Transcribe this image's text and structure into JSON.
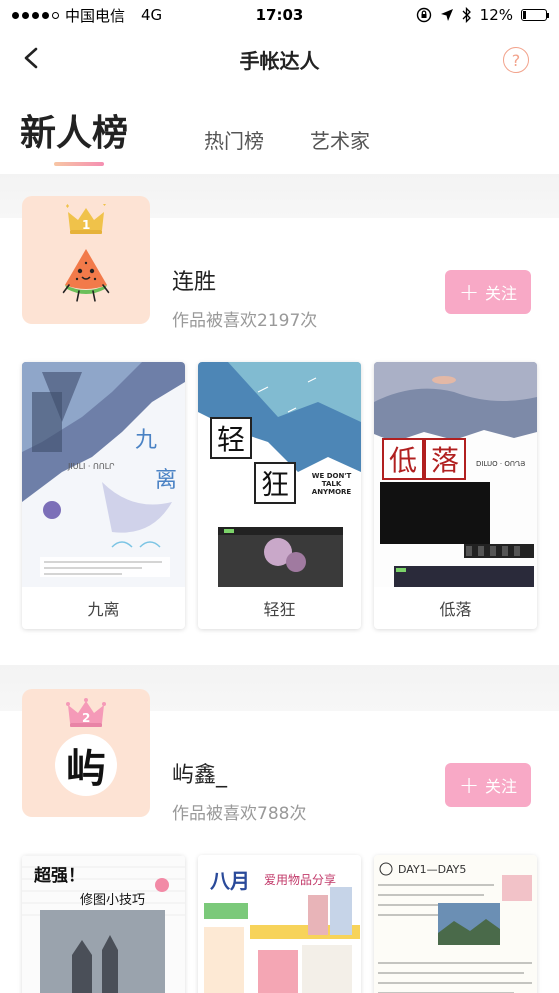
{
  "status": {
    "carrier": "中国电信",
    "network": "4G",
    "time": "17:03",
    "battery": "12%",
    "battery_level": 0.12
  },
  "nav": {
    "title": "手帐达人",
    "help_label": "?"
  },
  "tabs": [
    {
      "label": "新人榜",
      "active": true
    },
    {
      "label": "热门榜",
      "active": false
    },
    {
      "label": "艺术家",
      "active": false
    }
  ],
  "rankings": [
    {
      "rank": "1",
      "name": "连胜",
      "likes": "作品被喜欢2197次",
      "follow_label": "关注",
      "works": [
        {
          "title": "九离"
        },
        {
          "title": "轻狂"
        },
        {
          "title": "低落"
        }
      ]
    },
    {
      "rank": "2",
      "name": "屿鑫_",
      "likes": "作品被喜欢788次",
      "follow_label": "关注",
      "avatar_char": "屿",
      "works": [
        {
          "art_title": "超强！",
          "art_subtitle": "修图小技巧"
        },
        {
          "art_title": "八月",
          "art_subtitle": "爱用物品分享"
        },
        {
          "art_title": "DAY1—DAY5"
        }
      ]
    }
  ],
  "artwork_text": {
    "jiuli_big": "九",
    "jiuli_big2": "离",
    "jiuli_latin": "JIULI · ՈՈԼՐ",
    "qingkuang_1": "轻",
    "qingkuang_2": "狂",
    "qingkuang_en": "WE DON'T TALK ANYMORE",
    "diluo_1": "低",
    "diluo_2": "落",
    "diluo_latin": "DILUO · ՕՈՂՅ"
  },
  "colors": {
    "accent_pink": "#f8a9c6",
    "avatar_bg": "#fde3d4",
    "crown_gold": "#f0c24a",
    "crown_pink": "#f59ab8",
    "help_ring": "#f2a38c"
  }
}
